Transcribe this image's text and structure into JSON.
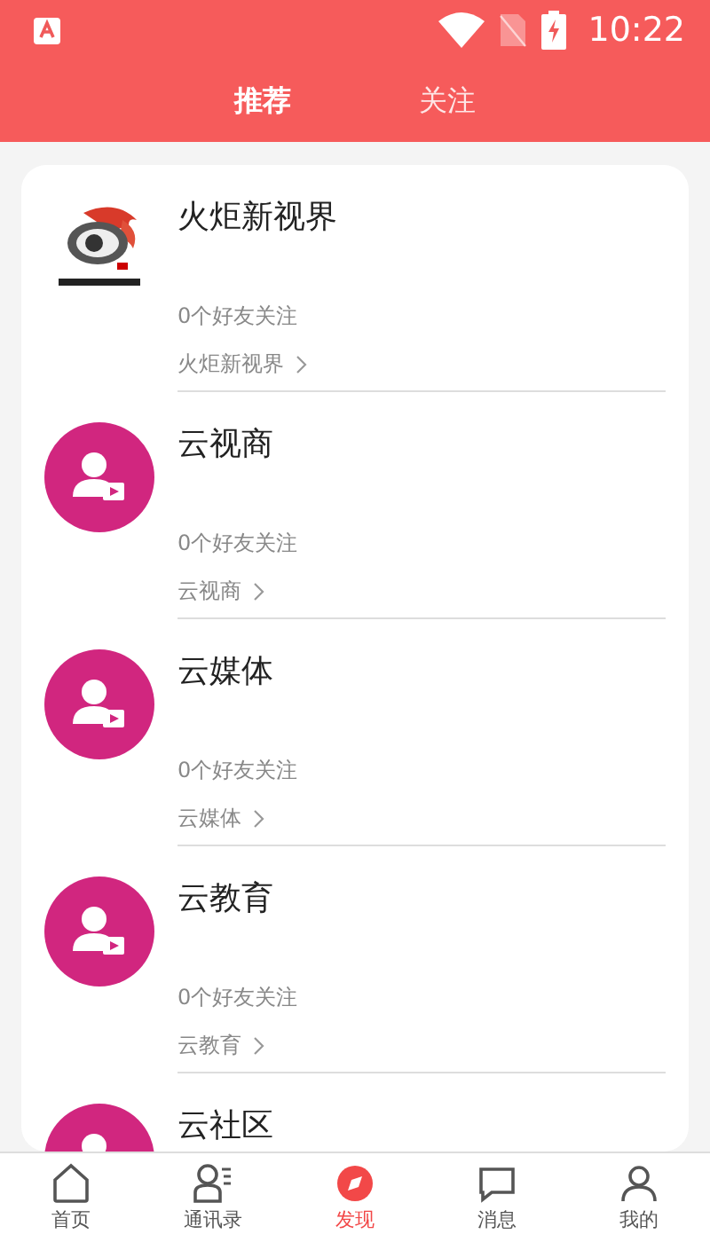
{
  "status_bar": {
    "time": "10:22"
  },
  "top_tabs": [
    {
      "label": "推荐",
      "selected": true
    },
    {
      "label": "关注",
      "selected": false
    }
  ],
  "channels": [
    {
      "kind": "logo",
      "title": "火炬新视界",
      "followers": "0个好友关注",
      "link": "火炬新视界"
    },
    {
      "kind": "avatar",
      "title": "云视商",
      "followers": "0个好友关注",
      "link": "云视商"
    },
    {
      "kind": "avatar",
      "title": "云媒体",
      "followers": "0个好友关注",
      "link": "云媒体"
    },
    {
      "kind": "avatar",
      "title": "云教育",
      "followers": "0个好友关注",
      "link": "云教育"
    },
    {
      "kind": "avatar",
      "title": "云社区"
    }
  ],
  "bottom_nav": [
    {
      "kind": "home",
      "label": "首页",
      "selected": false
    },
    {
      "kind": "contacts",
      "label": "通讯录",
      "selected": false
    },
    {
      "kind": "discover",
      "label": "发现",
      "selected": true
    },
    {
      "kind": "message",
      "label": "消息",
      "selected": false
    },
    {
      "kind": "me",
      "label": "我的",
      "selected": false
    }
  ]
}
